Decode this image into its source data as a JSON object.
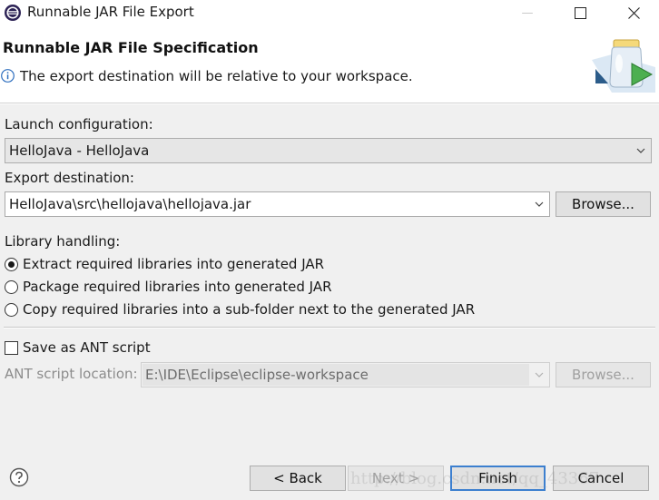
{
  "window": {
    "title": "Runnable JAR File Export",
    "minimize_glyph": "—",
    "maximize_glyph": "☐",
    "close_glyph": "✕"
  },
  "header": {
    "title": "Runnable JAR File Specification",
    "message": "The export destination will be relative to your workspace."
  },
  "launch": {
    "label": "Launch configuration:",
    "value": "HelloJava - HelloJava"
  },
  "export": {
    "label": "Export destination:",
    "value": "HelloJava\\src\\hellojava\\hellojava.jar",
    "browse_label": "Browse..."
  },
  "library": {
    "label": "Library handling:",
    "options": [
      {
        "label": "Extract required libraries into generated JAR",
        "checked": true
      },
      {
        "label": "Package required libraries into generated JAR",
        "checked": false
      },
      {
        "label": "Copy required libraries into a sub-folder next to the generated JAR",
        "checked": false
      }
    ]
  },
  "ant": {
    "checkbox_label": "Save as ANT script",
    "checked": false,
    "location_label": "ANT script location:",
    "location_value": "E:\\IDE\\Eclipse\\eclipse-workspace",
    "browse_label": "Browse..."
  },
  "footer": {
    "back_label": "< Back",
    "next_label": "Next >",
    "finish_label": "Finish",
    "cancel_label": "Cancel",
    "watermark": "http://blog.csdn.net/qq_43367"
  },
  "icons": {
    "app": "eclipse-icon",
    "info": "info-icon",
    "banner": "jar-export-icon",
    "help": "help-icon",
    "combo_arrow": "chevron-down-icon"
  },
  "colors": {
    "default_button_border": "#3c7fcf",
    "dialog_background": "#f0f0f0"
  }
}
